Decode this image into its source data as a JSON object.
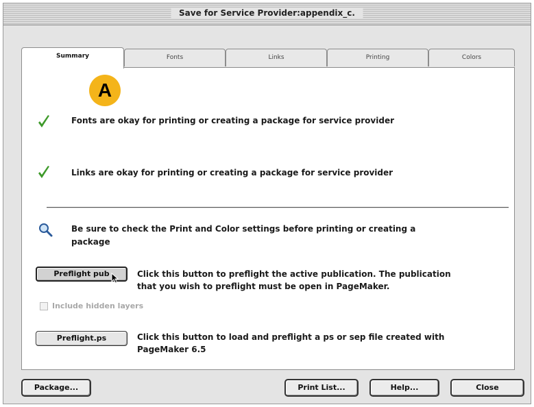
{
  "window": {
    "title": "Save for Service Provider:appendix_c."
  },
  "tabs": [
    {
      "label": "Summary",
      "active": true
    },
    {
      "label": "Fonts",
      "active": false
    },
    {
      "label": "Links",
      "active": false
    },
    {
      "label": "Printing",
      "active": false
    },
    {
      "label": "Colors",
      "active": false
    }
  ],
  "annotation": {
    "badge_label": "A",
    "badge_color": "#f4b41a"
  },
  "summary": {
    "fonts_status": {
      "icon": "checkmark-icon",
      "text": "Fonts are okay for printing or creating a package for service provider"
    },
    "links_status": {
      "icon": "checkmark-icon",
      "text": "Links are okay for printing or creating a package for service provider"
    },
    "note": {
      "icon": "magnifier-icon",
      "line1": "Be sure to check the Print and Color settings before printing or creating a",
      "line2": "package"
    },
    "preflight_pub": {
      "button_label": "Preflight pub",
      "desc_line1": "Click this button to preflight the active publication. The publication",
      "desc_line2": "that you wish to preflight must be open in PageMaker."
    },
    "include_hidden_layers": {
      "label": "Include hidden layers",
      "checked": false,
      "enabled": false
    },
    "preflight_ps": {
      "button_label": "Preflight.ps",
      "desc_line1": "Click this button to load and preflight a ps or sep file created with",
      "desc_line2": "PageMaker 6.5"
    }
  },
  "footer": {
    "package_label": "Package...",
    "print_list_label": "Print List...",
    "help_label": "Help...",
    "close_label": "Close"
  },
  "colors": {
    "check_green": "#3e9a2a",
    "badge": "#f4b41a",
    "disabled_text": "#a8a8a8"
  }
}
